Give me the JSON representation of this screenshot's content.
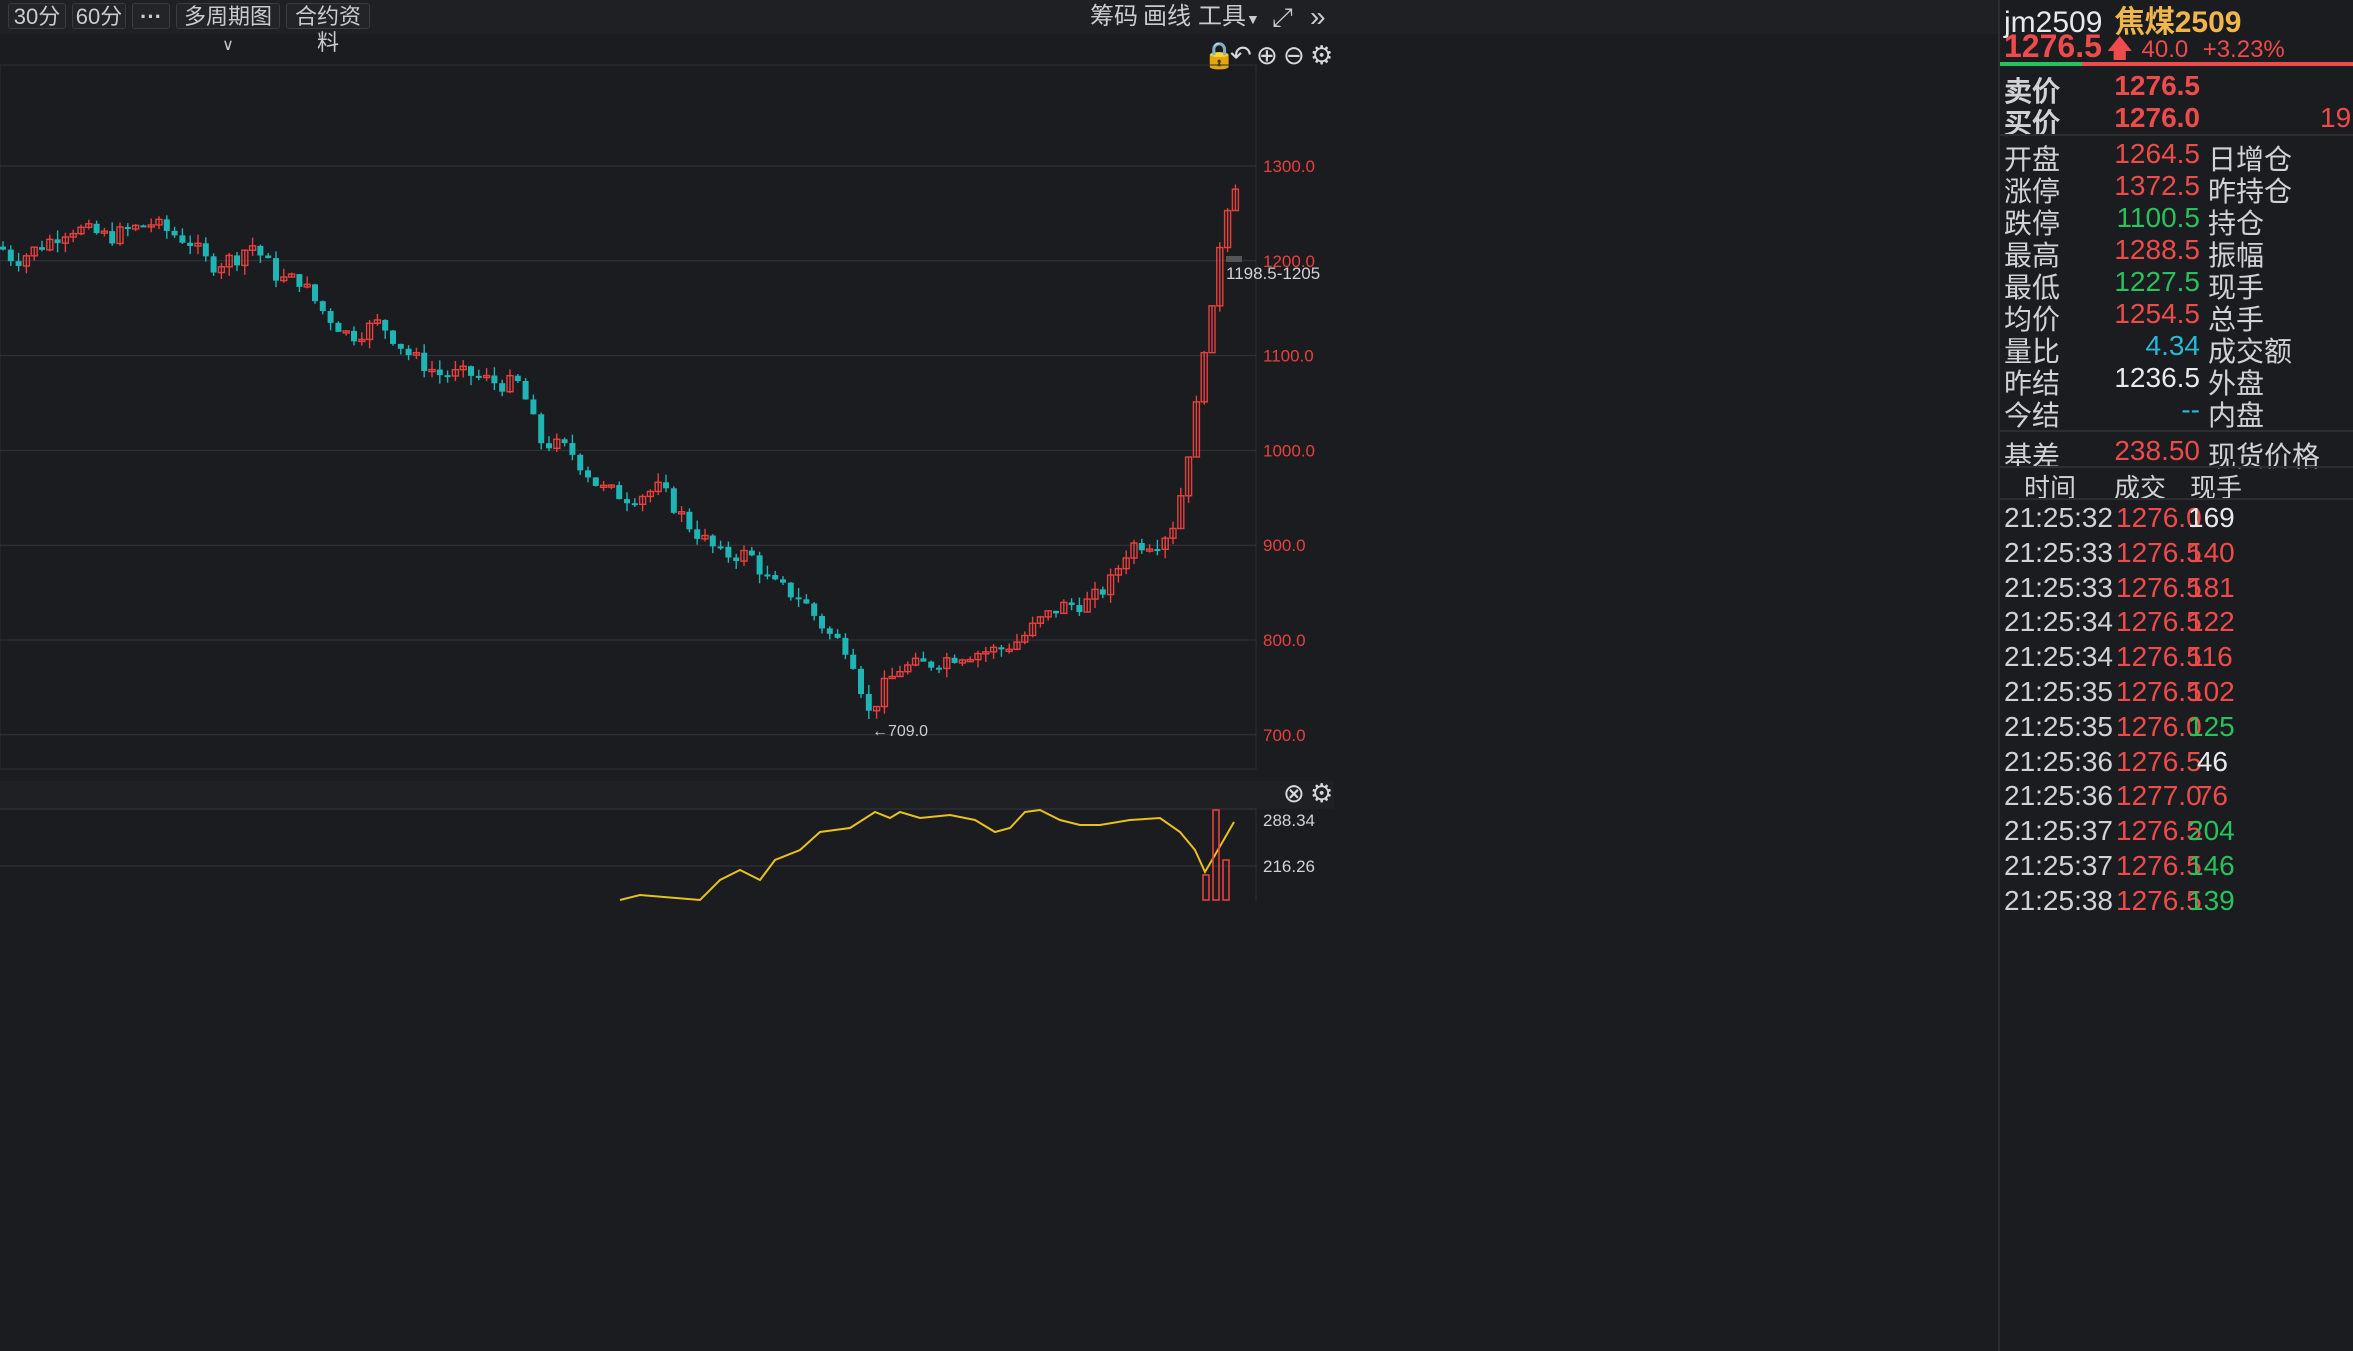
{
  "toolbar": {
    "period_30": "30分",
    "period_60": "60分",
    "more": "···",
    "multi_period": "多周期图",
    "contract_info": "合约资料",
    "chips": "筹码",
    "draw": "画线",
    "tools": "工具",
    "fullscreen_icon": "expand-icon",
    "collapse_icon": "double-chevron-icon"
  },
  "chart": {
    "y_ticks": [
      "1300.0",
      "1200.0",
      "1100.0",
      "1000.0",
      "900.0",
      "800.0",
      "700.0"
    ],
    "low_annotation": "←709.0",
    "price_label": "1198.5-1205",
    "sub_ticks": [
      "288.34",
      "216.26"
    ],
    "colors": {
      "up": "#e8403e",
      "down": "#1fb5b5",
      "line": "#e8c21a"
    }
  },
  "chart_data": {
    "type": "candlestick",
    "ylim": [
      670,
      1340
    ],
    "candles_ohlc_approx": "downtrend from ~1240 to low 709.0, then rally to ~1288.5",
    "volume_ylim": [
      0,
      310
    ]
  },
  "quote": {
    "code": "jm2509",
    "name": "焦煤2509",
    "last": "1276.5",
    "change": "40.0",
    "change_pct": "+3.23%",
    "ask_label": "卖价",
    "ask": "1276.5",
    "bid_label": "买价",
    "bid": "1276.0",
    "bid_size": "19",
    "fields": [
      {
        "label": "开盘",
        "value": "1264.5",
        "color": "red",
        "label2": "日增仓"
      },
      {
        "label": "涨停",
        "value": "1372.5",
        "color": "red",
        "label2": "昨持仓"
      },
      {
        "label": "跌停",
        "value": "1100.5",
        "color": "green",
        "label2": "持仓"
      },
      {
        "label": "最高",
        "value": "1288.5",
        "color": "red",
        "label2": "振幅"
      },
      {
        "label": "最低",
        "value": "1227.5",
        "color": "green",
        "label2": "现手"
      },
      {
        "label": "均价",
        "value": "1254.5",
        "color": "red",
        "label2": "总手"
      },
      {
        "label": "量比",
        "value": "4.34",
        "color": "cyan",
        "label2": "成交额"
      },
      {
        "label": "昨结",
        "value": "1236.5",
        "color": "white",
        "label2": "外盘"
      },
      {
        "label": "今结",
        "value": "--",
        "color": "cyan",
        "label2": "内盘"
      }
    ],
    "basis_label": "基差",
    "basis": "238.50",
    "spot_label": "现货价格"
  },
  "trades": {
    "headers": [
      "时间",
      "成交",
      "现手"
    ],
    "rows": [
      {
        "time": "21:25:32",
        "price": "1276.0",
        "qty": "169",
        "qc": "white"
      },
      {
        "time": "21:25:33",
        "price": "1276.5",
        "qty": "140",
        "qc": "red"
      },
      {
        "time": "21:25:33",
        "price": "1276.5",
        "qty": "181",
        "qc": "red"
      },
      {
        "time": "21:25:34",
        "price": "1276.5",
        "qty": "122",
        "qc": "red"
      },
      {
        "time": "21:25:34",
        "price": "1276.5",
        "qty": "116",
        "qc": "red"
      },
      {
        "time": "21:25:35",
        "price": "1276.5",
        "qty": "102",
        "qc": "red"
      },
      {
        "time": "21:25:35",
        "price": "1276.0",
        "qty": "125",
        "qc": "green"
      },
      {
        "time": "21:25:36",
        "price": "1276.5",
        "qty": "46",
        "qc": "white"
      },
      {
        "time": "21:25:36",
        "price": "1277.0",
        "qty": "76",
        "qc": "red"
      },
      {
        "time": "21:25:37",
        "price": "1276.5",
        "qty": "204",
        "qc": "green"
      },
      {
        "time": "21:25:37",
        "price": "1276.5",
        "qty": "146",
        "qc": "green"
      },
      {
        "time": "21:25:38",
        "price": "1276.5",
        "qty": "139",
        "qc": "green"
      }
    ]
  }
}
